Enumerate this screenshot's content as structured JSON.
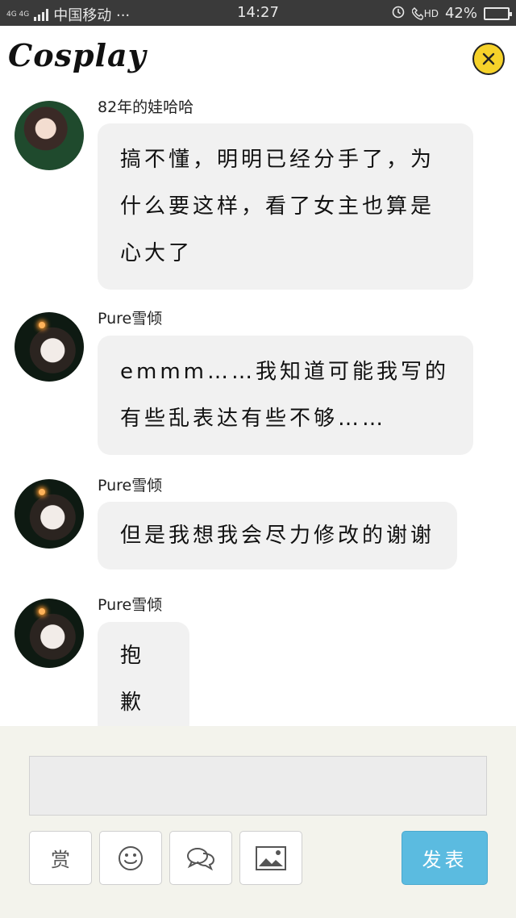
{
  "status_bar": {
    "network": "4G 4G",
    "carrier": "中国移动 ···",
    "time": "14:27",
    "hd": "HD",
    "battery_percent": "42%",
    "battery_level": 0.42
  },
  "header": {
    "title": "Cosplay"
  },
  "messages": [
    {
      "username": "82年的娃哈哈",
      "text": "搞不懂，明明已经分手了，为什么要这样，看了女主也算是心大了"
    },
    {
      "username": "Pure雪倾",
      "text": "emmm……我知道可能我写的有些乱表达有些不够……"
    },
    {
      "username": "Pure雪倾",
      "text": "但是我想我会尽力修改的谢谢"
    },
    {
      "username": "Pure雪倾",
      "text": "抱歉"
    }
  ],
  "composer": {
    "reward_label": "赏",
    "send_label": "发表"
  },
  "colors": {
    "status_bar_bg": "#3a3a3a",
    "close_button": "#f6d22a",
    "bubble_bg": "#f1f1f1",
    "composer_bg": "#f3f3ec",
    "send_button": "#5bbbe0"
  }
}
